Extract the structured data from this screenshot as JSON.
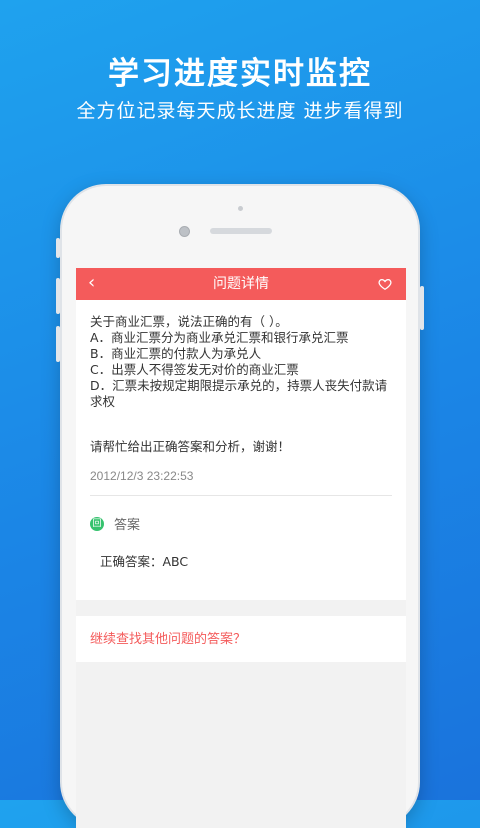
{
  "promo": {
    "title": "学习进度实时监控",
    "subtitle": "全方位记录每天成长进度  进步看得到"
  },
  "app": {
    "header": {
      "title": "问题详情",
      "back_icon": "chevron-left-icon",
      "favorite_icon": "heart-icon",
      "bar_color": "#f45b5b"
    },
    "question": {
      "lines": [
        "关于商业汇票，说法正确的有（  ）。",
        "A．商业汇票分为商业承兑汇票和银行承兑汇票",
        "B．商业汇票的付款人为承兑人",
        "C．出票人不得签发无对价的商业汇票",
        "D．汇票未按规定期限提示承兑的，持票人丧失付款请求权"
      ],
      "help_text": "请帮忙给出正确答案和分析，谢谢！",
      "timestamp": "2012/12/3 23:22:53"
    },
    "answer": {
      "badge": "回",
      "label": "答案",
      "correct": "正确答案：ABC"
    },
    "more_link": "继续查找其他问题的答案？",
    "accent_color": "#f45b5b",
    "answer_badge_color": "#36c26e"
  }
}
